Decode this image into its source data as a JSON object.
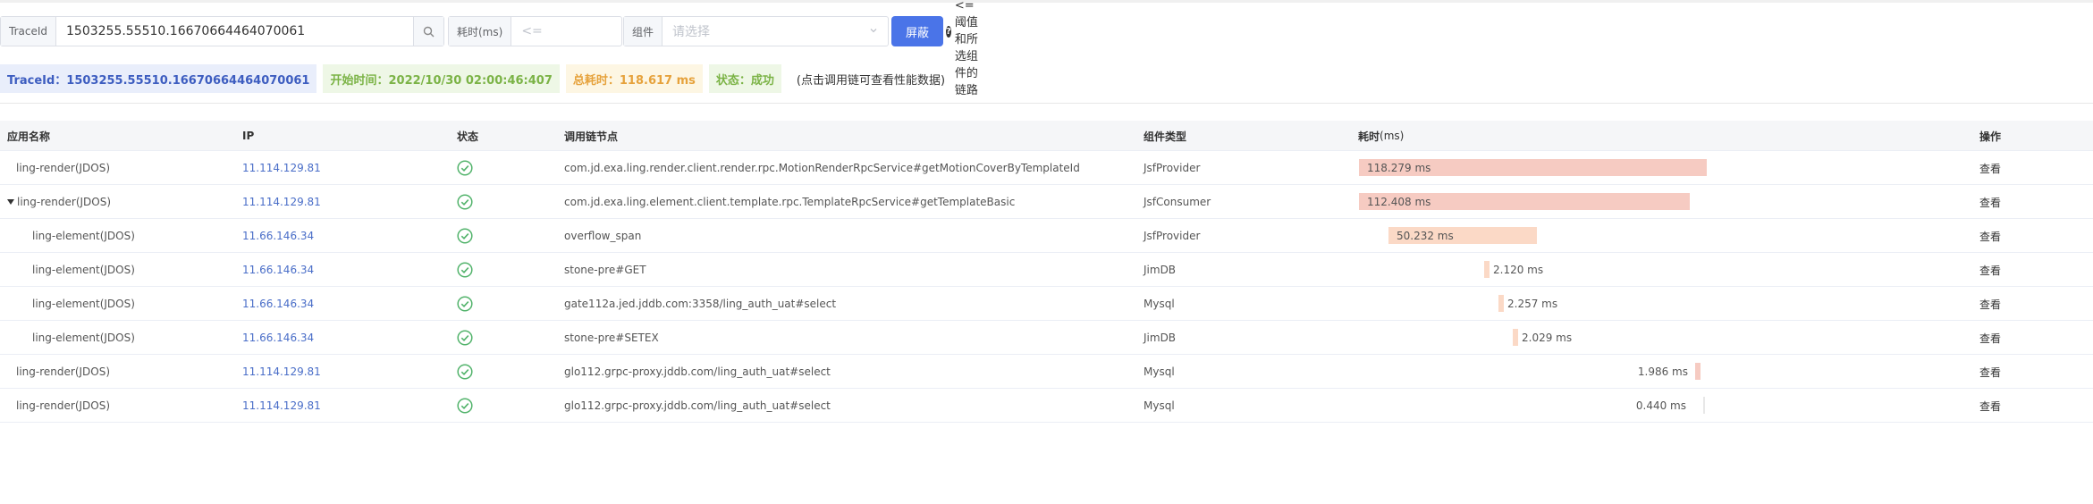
{
  "search": {
    "traceid_label": "TraceId",
    "traceid_value": "1503255.55510.16670664464070061",
    "duration_label": "耗时(ms)",
    "duration_placeholder": "<=",
    "component_label": "组件",
    "component_placeholder": "请选择",
    "filter_button": "屏蔽",
    "help_text": "过滤耗时<=阈值和所选组件的链路"
  },
  "summary": {
    "traceid": "TraceId：1503255.55510.16670664464070061",
    "start_time": "开始时间：2022/10/30 02:00:46:407",
    "total_time": "总耗时：118.617 ms",
    "status": "状态：成功",
    "hint": "(点击调用链可查看性能数据)"
  },
  "colors": {
    "primary": "#4a74e8",
    "ip_link": "#4a6ec8",
    "status_ok": "#52b36b",
    "bar_large": "#f6cbc2",
    "bar_small": "#fbd9c6"
  },
  "table": {
    "headers": {
      "app": "应用名称",
      "ip": "IP",
      "status": "状态",
      "node": "调用链节点",
      "type": "组件类型",
      "duration": "耗时",
      "duration_unit": "(ms)",
      "op": "操作"
    },
    "rows": [
      {
        "app": "ling-render(JDOS)",
        "ip": "11.114.129.81",
        "node": "com.jd.exa.ling.render.client.render.rpc.MotionRenderRpcService#getMotionCoverByTemplateId",
        "type": "JsfProvider",
        "duration": "118.279 ms",
        "op": "查看",
        "status_icon": "check-circle-icon"
      },
      {
        "app": "ling-render(JDOS)",
        "ip": "11.114.129.81",
        "node": "com.jd.exa.ling.element.client.template.rpc.TemplateRpcService#getTemplateBasic",
        "type": "JsfConsumer",
        "duration": "112.408 ms",
        "op": "查看",
        "status_icon": "check-circle-icon"
      },
      {
        "app": "ling-element(JDOS)",
        "ip": "11.66.146.34",
        "node": "overflow_span",
        "type": "JsfProvider",
        "duration": "50.232 ms",
        "op": "查看",
        "status_icon": "check-circle-icon"
      },
      {
        "app": "ling-element(JDOS)",
        "ip": "11.66.146.34",
        "node": "stone-pre#GET",
        "type": "JimDB",
        "duration": "2.120 ms",
        "op": "查看",
        "status_icon": "check-circle-icon"
      },
      {
        "app": "ling-element(JDOS)",
        "ip": "11.66.146.34",
        "node": "gate112a.jed.jddb.com:3358/ling_auth_uat#select",
        "type": "Mysql",
        "duration": "2.257 ms",
        "op": "查看",
        "status_icon": "check-circle-icon"
      },
      {
        "app": "ling-element(JDOS)",
        "ip": "11.66.146.34",
        "node": "stone-pre#SETEX",
        "type": "JimDB",
        "duration": "2.029 ms",
        "op": "查看",
        "status_icon": "check-circle-icon"
      },
      {
        "app": "ling-render(JDOS)",
        "ip": "11.114.129.81",
        "node": "glo112.grpc-proxy.jddb.com/ling_auth_uat#select",
        "type": "Mysql",
        "duration": "1.986 ms",
        "op": "查看",
        "status_icon": "check-circle-icon"
      },
      {
        "app": "ling-render(JDOS)",
        "ip": "11.114.129.81",
        "node": "glo112.grpc-proxy.jddb.com/ling_auth_uat#select",
        "type": "Mysql",
        "duration": "0.440 ms",
        "op": "查看",
        "status_icon": "check-circle-icon"
      }
    ]
  }
}
